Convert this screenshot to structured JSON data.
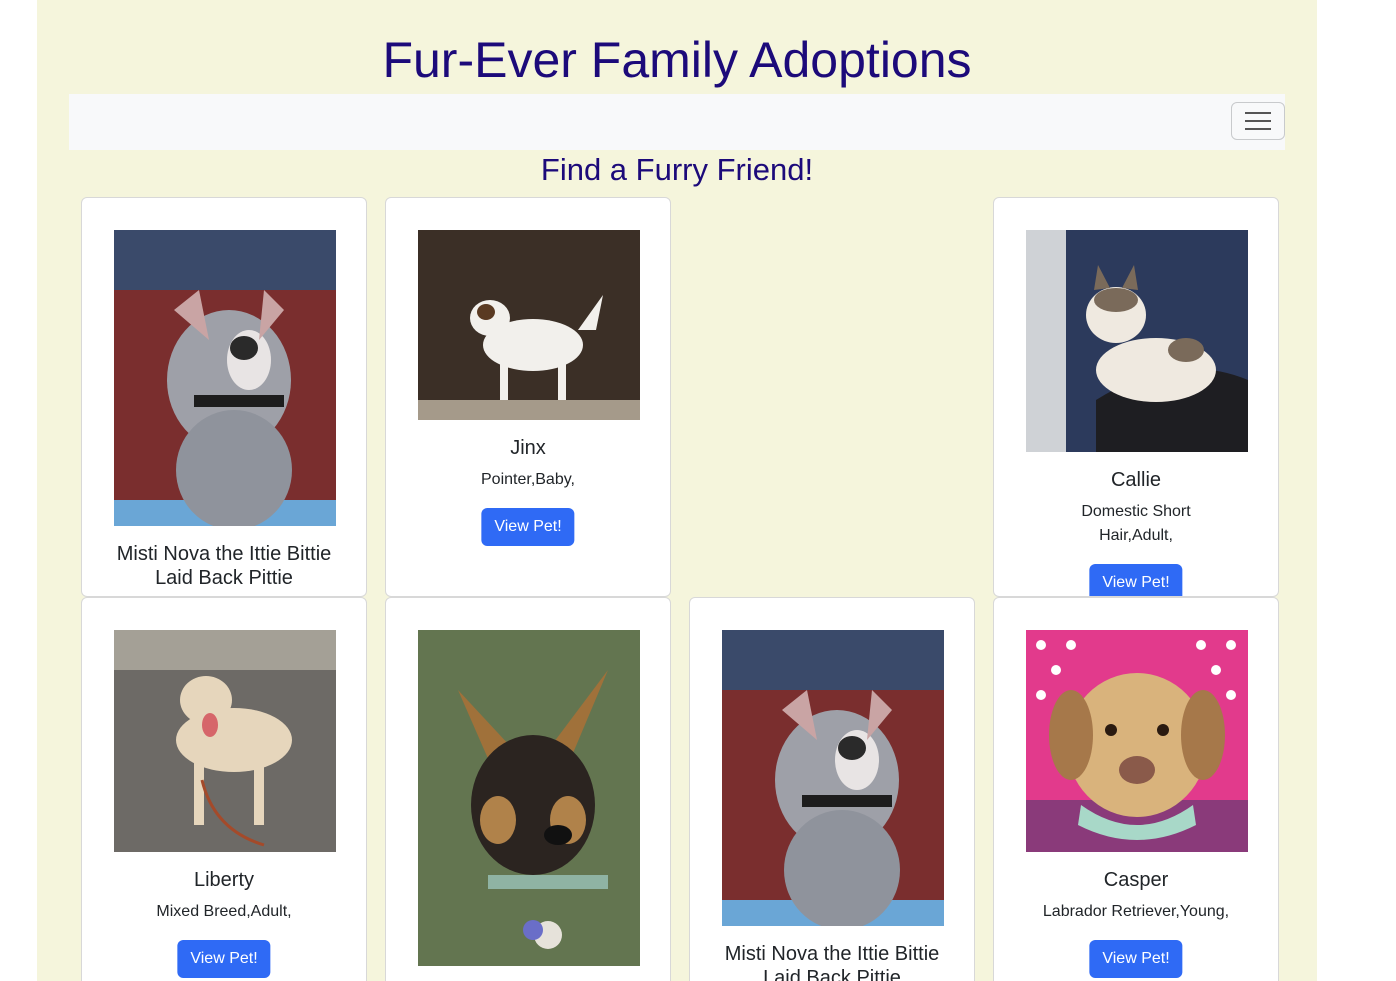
{
  "site": {
    "title": "Fur-Ever Family Adoptions"
  },
  "navbar": {
    "toggler_icon": "hamburger-icon"
  },
  "main": {
    "heading": "Find a Furry Friend!"
  },
  "pets": [
    {
      "name": "Misti Nova the Ittie Bittie Laid Back Pittie",
      "description": "",
      "button": "",
      "photo": "gray-white-pitbull-photo"
    },
    {
      "name": "Jinx",
      "description": "Pointer,Baby,",
      "button": "View Pet!",
      "photo": "white-pointer-puppy-photo"
    },
    {
      "name": "Callie",
      "description": "Domestic Short Hair,Adult,",
      "button": "View Pet!",
      "photo": "calico-cat-photo"
    },
    {
      "name": "Liberty",
      "description": "Mixed Breed,Adult,",
      "button": "View Pet!",
      "photo": "tan-mixed-dog-photo"
    },
    {
      "name": "",
      "description": "",
      "button": "",
      "photo": "german-shepherd-puppy-photo"
    },
    {
      "name": "Misti Nova the Ittie Bittie Laid Back Pittie",
      "description": "",
      "button": "",
      "photo": "gray-white-pitbull-photo"
    },
    {
      "name": "Casper",
      "description": "Labrador Retriever,Young,",
      "button": "View Pet!",
      "photo": "labrador-retriever-photo"
    }
  ],
  "colors": {
    "page_background": "#f5f5dc",
    "title_color": "#1c0a7a",
    "navbar_background": "#f8f9fa",
    "button_background": "#2f6af5"
  }
}
